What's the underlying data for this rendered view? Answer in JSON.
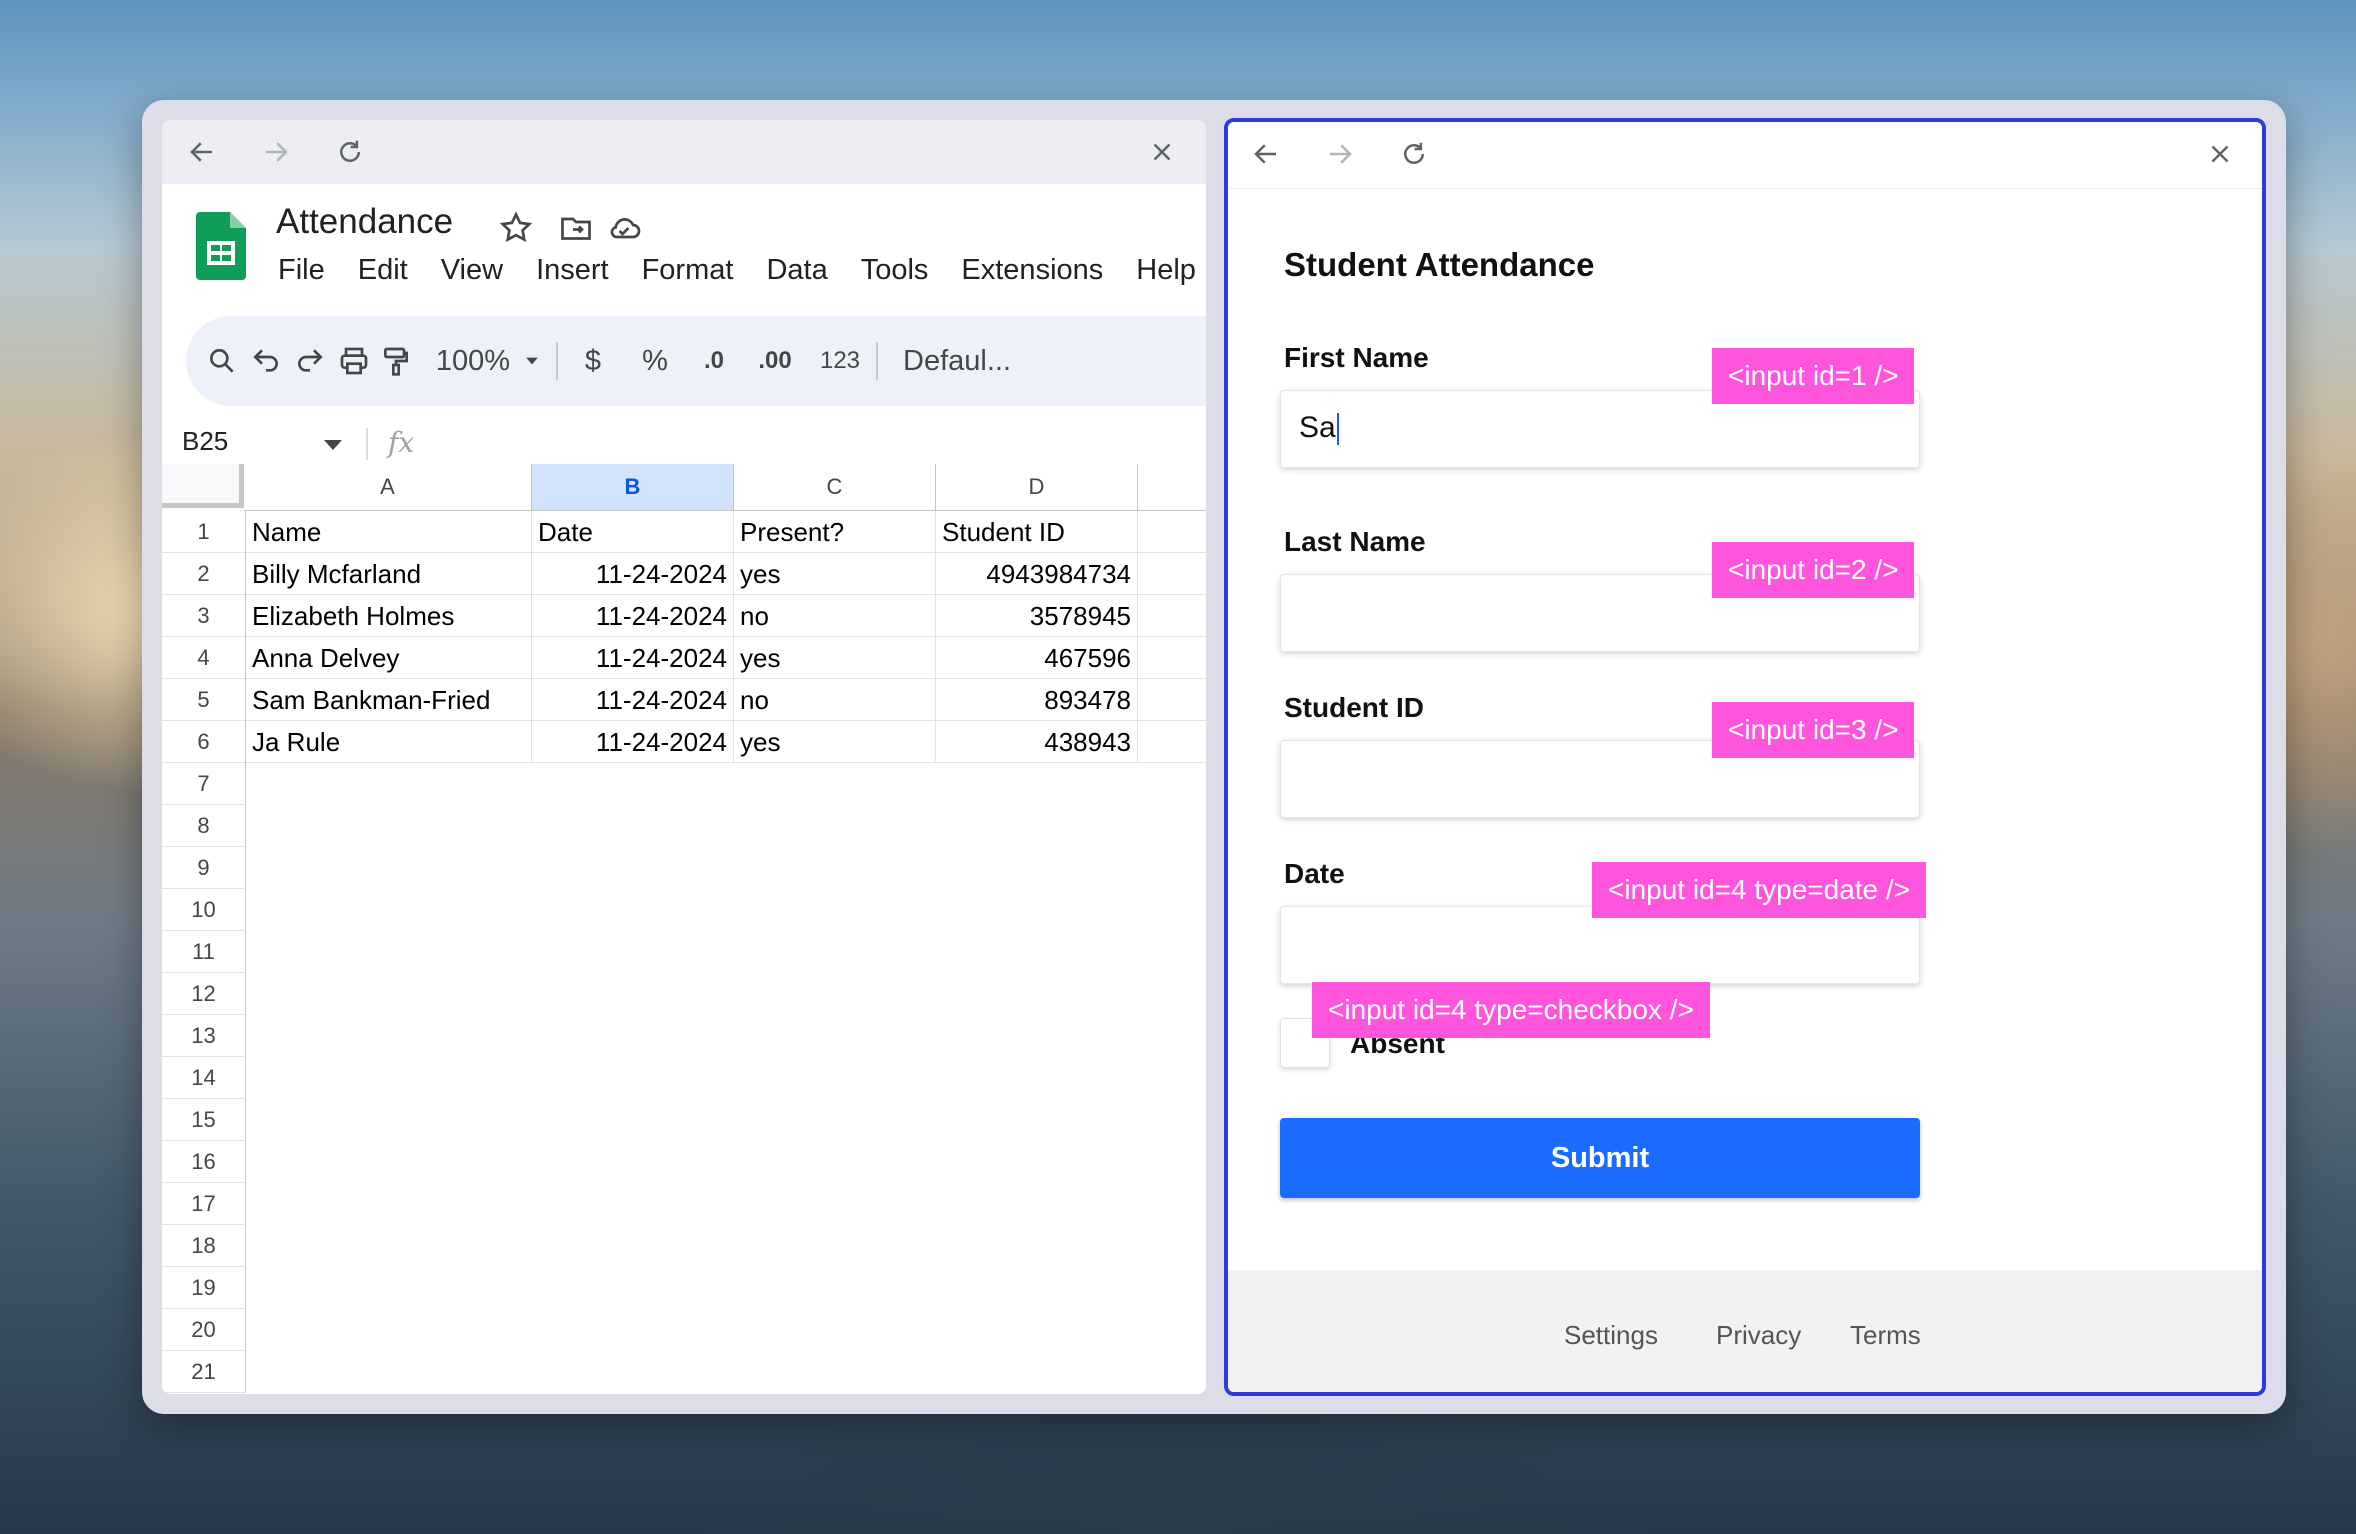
{
  "left_browser": {
    "nav": {
      "back": "back-arrow",
      "forward": "forward-arrow",
      "reload": "reload",
      "close": "close"
    },
    "doc_title": "Attendance",
    "menu": [
      "File",
      "Edit",
      "View",
      "Insert",
      "Format",
      "Data",
      "Tools",
      "Extensions",
      "Help"
    ],
    "toolbar": {
      "zoom": "100%",
      "currency": "$",
      "percent": "%",
      "dec_decrease": ".0",
      "dec_increase": ".00",
      "number_format": "123",
      "font": "Defaul..."
    },
    "name_box": "B25",
    "fx": "fx",
    "columns": [
      "A",
      "B",
      "C",
      "D"
    ],
    "selected_column": "B",
    "rows": [
      "1",
      "2",
      "3",
      "4",
      "5",
      "6",
      "7",
      "8",
      "9",
      "10",
      "11",
      "12",
      "13",
      "14",
      "15",
      "16",
      "17",
      "18",
      "19",
      "20",
      "21"
    ],
    "table": [
      [
        "Name",
        "Date",
        "Present?",
        "Student ID"
      ],
      [
        "Billy Mcfarland",
        "11-24-2024",
        "yes",
        "4943984734"
      ],
      [
        "Elizabeth Holmes",
        "11-24-2024",
        "no",
        "3578945"
      ],
      [
        "Anna Delvey",
        "11-24-2024",
        "yes",
        "467596"
      ],
      [
        "Sam Bankman-Fried",
        "11-24-2024",
        "no",
        "893478"
      ],
      [
        "Ja Rule",
        "11-24-2024",
        "yes",
        "438943"
      ]
    ]
  },
  "form": {
    "title": "Student Attendance",
    "first_name_label": "First Name",
    "first_name_value": "Sa",
    "last_name_label": "Last Name",
    "student_id_label": "Student ID",
    "date_label": "Date",
    "absent_label": "Absent",
    "submit_label": "Submit",
    "footer": [
      "Settings",
      "Privacy",
      "Terms"
    ]
  },
  "overlay_tags": {
    "t1": "<input id=1 />",
    "t2": "<input id=2 />",
    "t3": "<input id=3 />",
    "t4": "<input id=4 type=date />",
    "t5": "<input id=4 type=checkbox />"
  },
  "colors": {
    "accent_blue": "#1a6bff",
    "tag_pink": "#ff55dd",
    "window_border": "#2b3bdc",
    "sheets_green": "#0f9d58"
  }
}
